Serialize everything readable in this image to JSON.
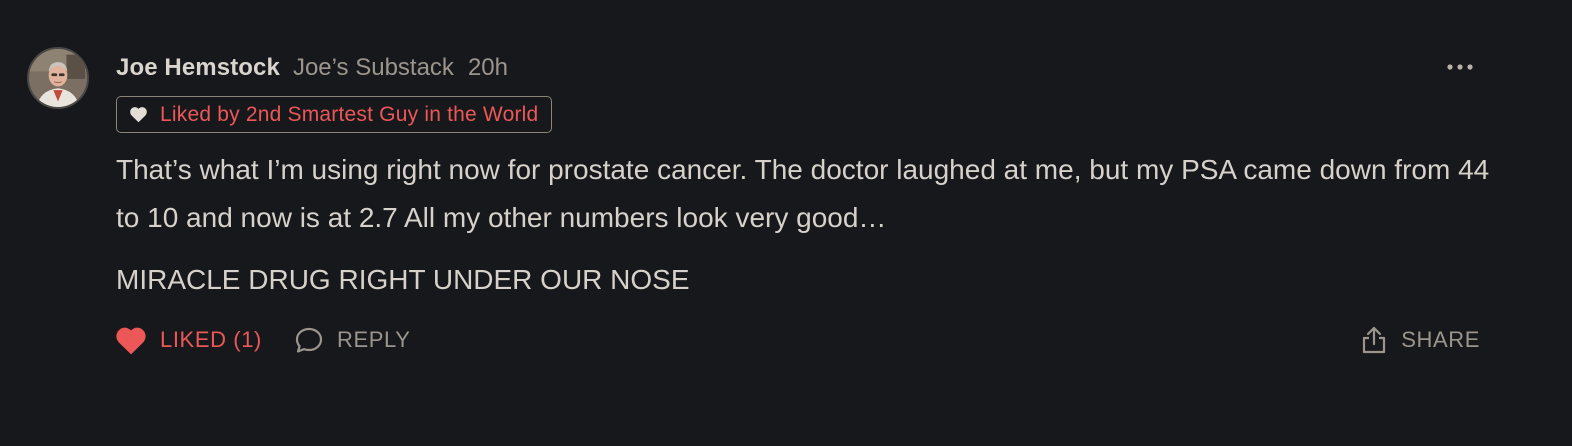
{
  "comment": {
    "author": "Joe Hemstock",
    "publication": "Joe’s Substack",
    "time_ago": "20h",
    "liked_by": "Liked by 2nd Smartest Guy in the World",
    "body": [
      "That’s what I’m using right now for prostate cancer. The doctor laughed at me, but my PSA came down from 44 to 10 and now is at 2.7 All my other numbers look very good…",
      "MIRACLE DRUG RIGHT UNDER OUR NOSE"
    ]
  },
  "actions": {
    "like_label": "LIKED (1)",
    "reply_label": "REPLY",
    "share_label": "SHARE"
  },
  "icons": {
    "avatar": "avatar-photo",
    "more": "ellipsis-icon",
    "liked_by": "heart-icon",
    "like": "heart-filled-icon",
    "reply": "speech-bubble-icon",
    "share": "share-upload-icon"
  },
  "colors": {
    "background": "#17181b",
    "accent_red": "#ec5757",
    "text_primary": "#d6d1ca",
    "text_muted": "#9b958d"
  }
}
